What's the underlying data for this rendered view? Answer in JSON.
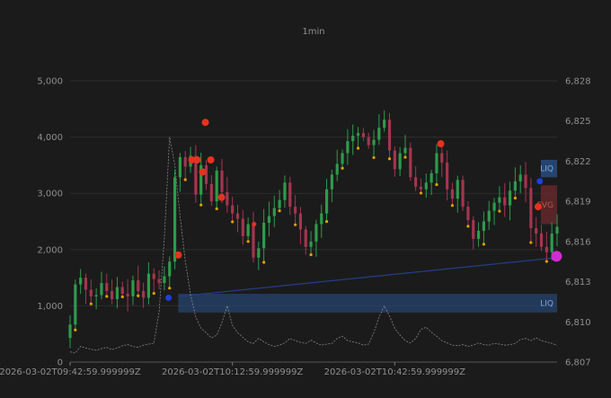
{
  "chart_data": {
    "type": "candlestick",
    "title": "1min",
    "x_tick_labels": [
      "2026-03-02T09:42:59.999999Z",
      "2026-03-02T10:12:59.999999Z",
      "2026-03-02T10:42:59.999999Z"
    ],
    "x_tick_minutes": [
      0,
      30,
      60
    ],
    "x_range_minutes": [
      0,
      90
    ],
    "left_axis": {
      "range": [
        0,
        5000
      ],
      "ticks": [
        0,
        1000,
        2000,
        3000,
        4000,
        5000
      ],
      "tick_labels": [
        "0",
        "1,000",
        "2,000",
        "3,000",
        "4,000",
        "5,000"
      ]
    },
    "right_axis": {
      "range": [
        6807,
        6828
      ],
      "ticks": [
        6807,
        6810,
        6813,
        6816,
        6819,
        6822,
        6825,
        6828
      ],
      "tick_labels": [
        "6,807",
        "6,810",
        "6,813",
        "6,816",
        "6,819",
        "6,822",
        "6,825",
        "6,828"
      ]
    },
    "grid": true,
    "candles_close_series": [
      6809.8,
      6812.8,
      6813.3,
      6812.4,
      6811.9,
      6812.0,
      6812.9,
      6812.3,
      6811.7,
      6812.6,
      6812.1,
      6811.9,
      6813.1,
      6812.3,
      6811.8,
      6813.6,
      6813.2,
      6812.9,
      6813.4,
      6814.5,
      6820.8,
      6822.3,
      6821.6,
      6822.4,
      6819.5,
      6821.7,
      6820.3,
      6819.0,
      6821.3,
      6819.7,
      6818.7,
      6818.1,
      6817.7,
      6816.4,
      6817.3,
      6814.8,
      6815.5,
      6817.4,
      6817.9,
      6818.5,
      6819.1,
      6820.4,
      6818.6,
      6818.1,
      6816.9,
      6815.6,
      6816.0,
      6817.3,
      6818.1,
      6819.9,
      6821.0,
      6821.8,
      6822.6,
      6823.5,
      6823.9,
      6824.1,
      6823.8,
      6823.2,
      6823.6,
      6824.5,
      6825.1,
      6822.8,
      6821.4,
      6822.6,
      6823.0,
      6820.8,
      6820.1,
      6819.9,
      6820.4,
      6821.1,
      6822.6,
      6821.9,
      6819.9,
      6819.2,
      6820.6,
      6818.6,
      6817.6,
      6816.2,
      6816.8,
      6817.5,
      6818.3,
      6818.9,
      6819.3,
      6818.7,
      6819.8,
      6820.5,
      6821.0,
      6820.0,
      6817.0,
      6816.6,
      6815.6,
      6815.2,
      6816.6,
      6817.1
    ],
    "volume_series": [
      180,
      160,
      280,
      250,
      230,
      210,
      240,
      260,
      220,
      250,
      290,
      310,
      280,
      260,
      300,
      320,
      330,
      900,
      2200,
      4000,
      3500,
      2600,
      1800,
      1200,
      800,
      600,
      520,
      430,
      480,
      700,
      1000,
      650,
      520,
      440,
      360,
      330,
      420,
      360,
      310,
      280,
      300,
      340,
      420,
      380,
      350,
      330,
      390,
      340,
      300,
      320,
      330,
      420,
      460,
      380,
      360,
      340,
      300,
      320,
      520,
      800,
      1000,
      820,
      600,
      480,
      380,
      340,
      420,
      580,
      620,
      530,
      460,
      380,
      340,
      300,
      290,
      310,
      280,
      300,
      340,
      310,
      300,
      330,
      320,
      300,
      310,
      330,
      400,
      420,
      380,
      430,
      380,
      360,
      330,
      300
    ],
    "zones": [
      {
        "label": "LIQ",
        "price_top": 6822.1,
        "price_bottom": 6820.8
      },
      {
        "label": "FVG",
        "price_top": 6820.2,
        "price_bottom": 6817.3
      },
      {
        "label": "LIQ",
        "price_top": 6812.1,
        "price_bottom": 6810.7
      }
    ],
    "colors": {
      "up": "#2e9b4c",
      "down": "#a3364f",
      "signal": "#e6321e",
      "liquidity": "#2a4f84",
      "fvg": "#6e2a2d",
      "text": "#8f8f8f",
      "background": "#1b1b1b"
    }
  }
}
